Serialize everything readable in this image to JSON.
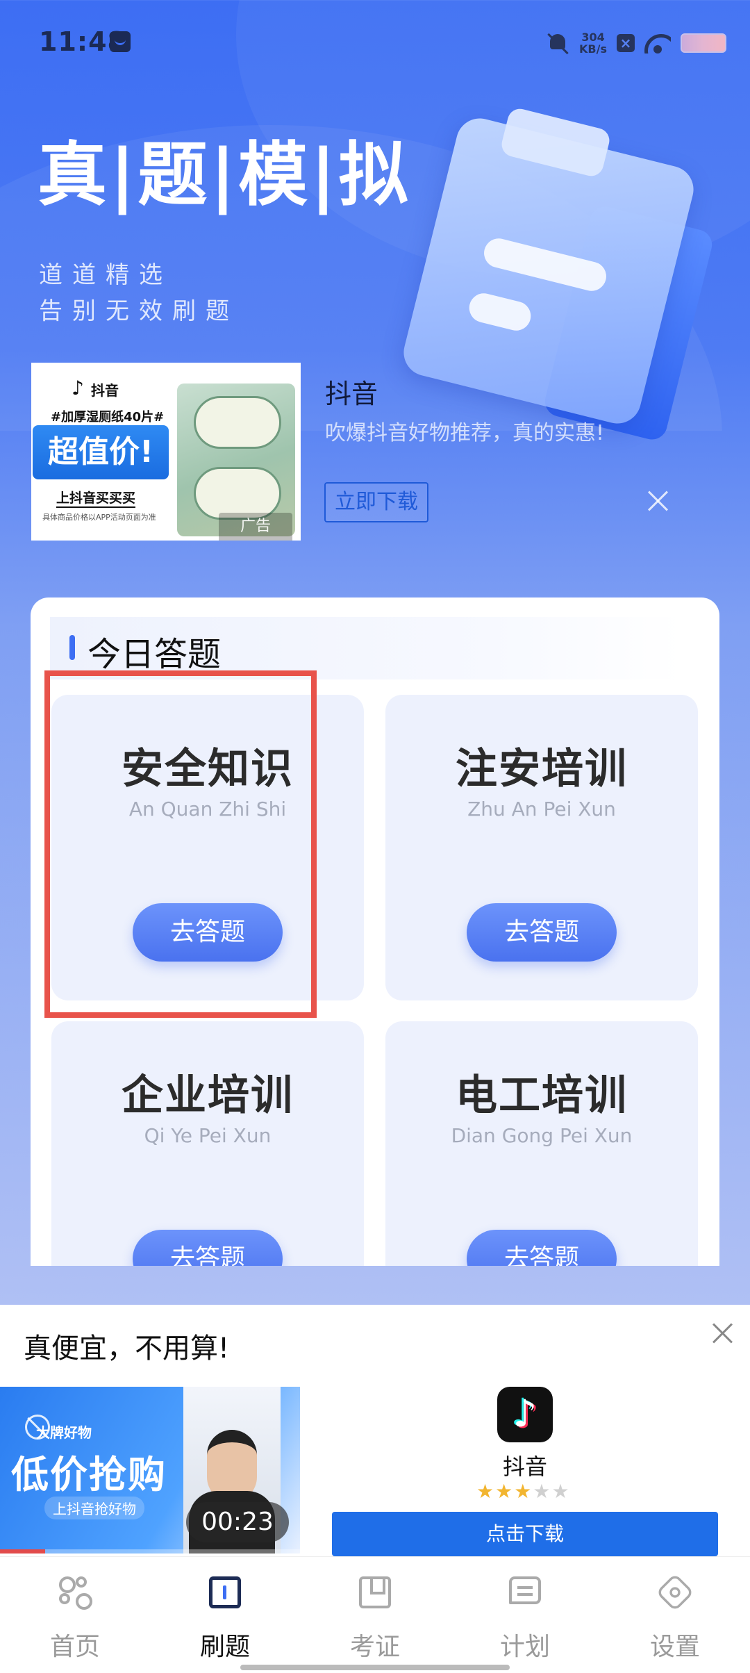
{
  "status_bar": {
    "time": "11:48",
    "speed_value": "304",
    "speed_unit": "KB/s"
  },
  "hero": {
    "title": "真|题|模|拟",
    "subtitle_line1": "道道精选",
    "subtitle_line2": "告别无效刷题"
  },
  "top_ad": {
    "brand_small": "抖音",
    "tag": "#加厚湿厕纸40片#",
    "price_label": "超值价!",
    "buy_label": "上抖音买买买",
    "note": "具体商品价格以APP活动页面为准",
    "badge": "广告",
    "app_name": "抖音",
    "description": "吹爆抖音好物推荐，真的实惠!",
    "download_button": "立即下载"
  },
  "section": {
    "title": "今日答题"
  },
  "quiz_cards": [
    {
      "title": "安全知识",
      "pinyin": "An Quan Zhi Shi",
      "button": "去答题"
    },
    {
      "title": "注安培训",
      "pinyin": "Zhu An Pei Xun",
      "button": "去答题"
    },
    {
      "title": "企业培训",
      "pinyin": "Qi Ye Pei Xun",
      "button": "去答题"
    },
    {
      "title": "电工培训",
      "pinyin": "Dian Gong Pei Xun",
      "button": "去答题"
    }
  ],
  "bottom_ad": {
    "title": "真便宜，不用算!",
    "video_brand": "大牌好物",
    "video_headline": "低价抢购",
    "video_sub": "上抖音抢好物",
    "video_timer": "00:23",
    "video_progress": 0.15,
    "app_name": "抖音",
    "rating": 3,
    "rating_max": 5,
    "download_button": "点击下载"
  },
  "nav": {
    "items": [
      {
        "label": "首页",
        "icon": "home-grid-icon",
        "active": false
      },
      {
        "label": "刷题",
        "icon": "book-icon",
        "active": true
      },
      {
        "label": "考证",
        "icon": "certificate-icon",
        "active": false
      },
      {
        "label": "计划",
        "icon": "plan-message-icon",
        "active": false
      },
      {
        "label": "设置",
        "icon": "settings-icon",
        "active": false
      }
    ]
  },
  "colors": {
    "accent": "#3d6ef3",
    "highlight": "#e8534b",
    "download_blue": "#1f6ee8"
  }
}
